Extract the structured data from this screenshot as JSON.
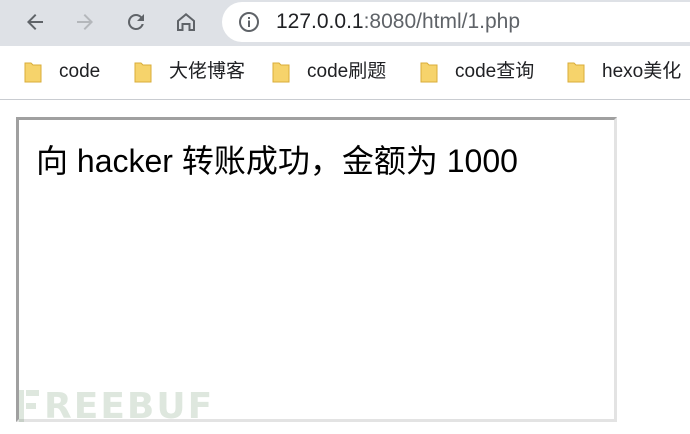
{
  "browser": {
    "nav": {
      "back_icon": "arrow-left-icon",
      "forward_icon": "arrow-right-icon",
      "reload_icon": "reload-icon",
      "home_icon": "home-icon"
    },
    "address_bar": {
      "host": "127.0.0.1",
      "rest": ":8080/html/1.php",
      "icon": "info-icon"
    },
    "bookmarks": [
      {
        "label": "code",
        "icon": "folder-icon"
      },
      {
        "label": "大佬博客",
        "icon": "folder-icon"
      },
      {
        "label": "code刷题",
        "icon": "folder-icon"
      },
      {
        "label": "code查询",
        "icon": "folder-icon"
      },
      {
        "label": "hexo美化",
        "icon": "folder-icon"
      }
    ]
  },
  "page": {
    "message": "向 hacker 转账成功，金额为 1000"
  },
  "watermark": {
    "text": "REEBUF"
  },
  "colors": {
    "toolbar_bg": "#dee1e6",
    "folder_yellow": "#f6d36b",
    "frame_dark": "#a0a0a0",
    "frame_light": "#e3e3e3"
  }
}
